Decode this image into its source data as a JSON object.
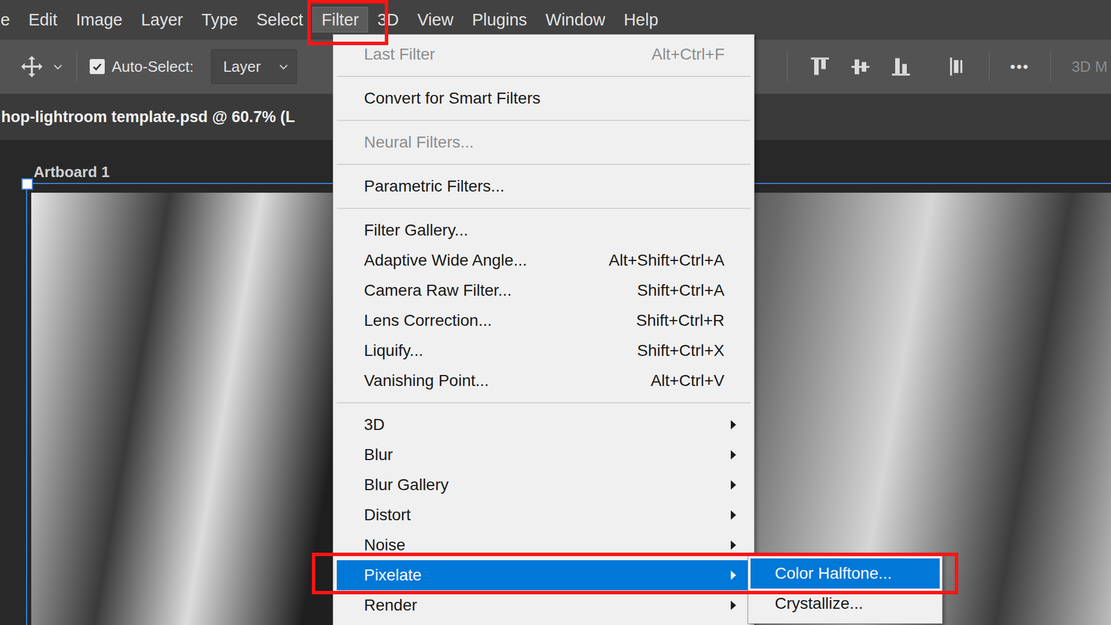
{
  "menu_bar": {
    "items": [
      {
        "label": "e",
        "selected": false
      },
      {
        "label": "Edit",
        "selected": false
      },
      {
        "label": "Image",
        "selected": false
      },
      {
        "label": "Layer",
        "selected": false
      },
      {
        "label": "Type",
        "selected": false
      },
      {
        "label": "Select",
        "selected": false
      },
      {
        "label": "Filter",
        "selected": true
      },
      {
        "label": "3D",
        "selected": false
      },
      {
        "label": "View",
        "selected": false
      },
      {
        "label": "Plugins",
        "selected": false
      },
      {
        "label": "Window",
        "selected": false
      },
      {
        "label": "Help",
        "selected": false
      }
    ]
  },
  "options_bar": {
    "auto_select": {
      "label": "Auto-Select:",
      "checked": true
    },
    "target": {
      "value": "Layer"
    },
    "more": "•••",
    "cut_label": "3D M"
  },
  "document_tab": {
    "title": "hop-lightroom template.psd @ 60.7% (L"
  },
  "artboard": {
    "name": "Artboard 1"
  },
  "filter_menu": {
    "items": [
      {
        "kind": "item",
        "label": "Last Filter",
        "shortcut": "Alt+Ctrl+F",
        "disabled": true,
        "has_submenu": false,
        "selected": false
      },
      {
        "kind": "separator"
      },
      {
        "kind": "item",
        "label": "Convert for Smart Filters",
        "disabled": false,
        "has_submenu": false,
        "selected": false
      },
      {
        "kind": "separator"
      },
      {
        "kind": "item",
        "label": "Neural Filters...",
        "disabled": true,
        "has_submenu": false,
        "selected": false
      },
      {
        "kind": "separator"
      },
      {
        "kind": "item",
        "label": "Parametric Filters...",
        "disabled": false,
        "has_submenu": false,
        "selected": false
      },
      {
        "kind": "separator"
      },
      {
        "kind": "item",
        "label": "Filter Gallery...",
        "disabled": false,
        "has_submenu": false,
        "selected": false
      },
      {
        "kind": "item",
        "label": "Adaptive Wide Angle...",
        "shortcut": "Alt+Shift+Ctrl+A",
        "disabled": false,
        "has_submenu": false,
        "selected": false
      },
      {
        "kind": "item",
        "label": "Camera Raw Filter...",
        "shortcut": "Shift+Ctrl+A",
        "disabled": false,
        "has_submenu": false,
        "selected": false
      },
      {
        "kind": "item",
        "label": "Lens Correction...",
        "shortcut": "Shift+Ctrl+R",
        "disabled": false,
        "has_submenu": false,
        "selected": false
      },
      {
        "kind": "item",
        "label": "Liquify...",
        "shortcut": "Shift+Ctrl+X",
        "disabled": false,
        "has_submenu": false,
        "selected": false
      },
      {
        "kind": "item",
        "label": "Vanishing Point...",
        "shortcut": "Alt+Ctrl+V",
        "disabled": false,
        "has_submenu": false,
        "selected": false
      },
      {
        "kind": "separator"
      },
      {
        "kind": "item",
        "label": "3D",
        "disabled": false,
        "has_submenu": true,
        "selected": false
      },
      {
        "kind": "item",
        "label": "Blur",
        "disabled": false,
        "has_submenu": true,
        "selected": false
      },
      {
        "kind": "item",
        "label": "Blur Gallery",
        "disabled": false,
        "has_submenu": true,
        "selected": false
      },
      {
        "kind": "item",
        "label": "Distort",
        "disabled": false,
        "has_submenu": true,
        "selected": false
      },
      {
        "kind": "item",
        "label": "Noise",
        "disabled": false,
        "has_submenu": true,
        "selected": false
      },
      {
        "kind": "item",
        "label": "Pixelate",
        "disabled": false,
        "has_submenu": true,
        "selected": true
      },
      {
        "kind": "item",
        "label": "Render",
        "disabled": false,
        "has_submenu": true,
        "selected": false
      }
    ]
  },
  "submenu": {
    "items": [
      {
        "label": "Color Halftone...",
        "selected": true
      },
      {
        "label": "Crystallize...",
        "selected": false
      }
    ]
  }
}
